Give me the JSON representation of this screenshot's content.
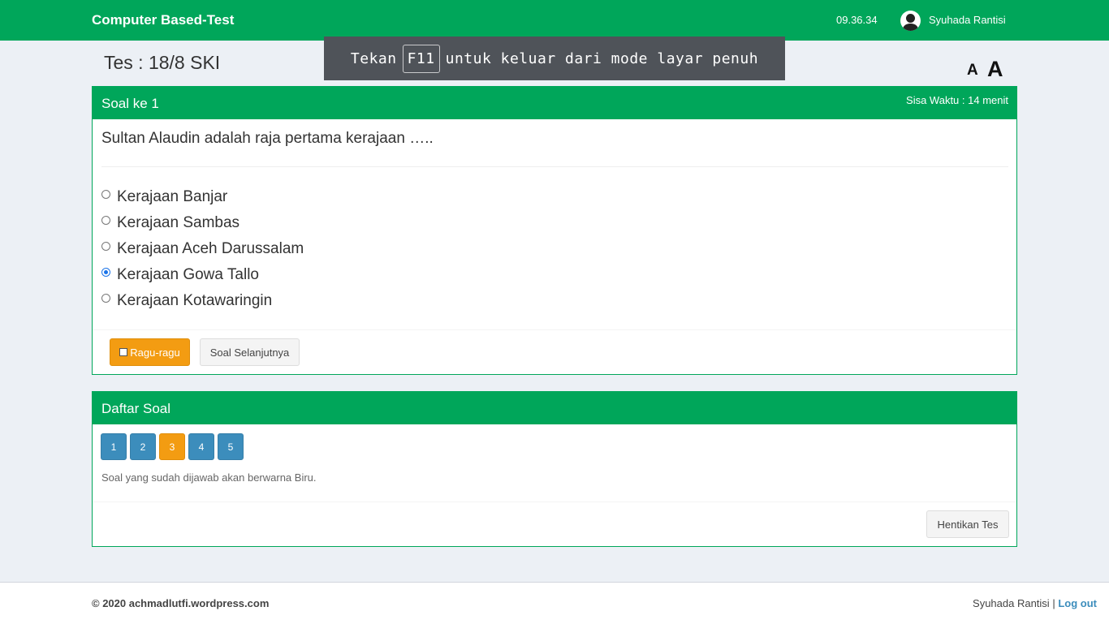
{
  "navbar": {
    "brand": "Computer Based-Test",
    "time": "09.36.34",
    "username": "Syuhada Rantisi",
    "avatar_icon": "user-avatar-icon"
  },
  "page": {
    "test_title": "Tes : 18/8 SKI",
    "font_small_label": "A",
    "font_large_label": "A"
  },
  "fullscreen_banner": {
    "before": "Tekan",
    "key": "F11",
    "after": "untuk keluar dari mode layar penuh"
  },
  "question_box": {
    "title": "Soal ke 1",
    "timer": "Sisa Waktu : 14 menit",
    "question": "Sultan Alaudin adalah raja pertama kerajaan …..",
    "options": [
      {
        "label": "Kerajaan Banjar",
        "checked": false
      },
      {
        "label": "Kerajaan Sambas",
        "checked": false
      },
      {
        "label": "Kerajaan Aceh Darussalam",
        "checked": false
      },
      {
        "label": "Kerajaan Gowa Tallo",
        "checked": true
      },
      {
        "label": "Kerajaan Kotawaringin",
        "checked": false
      }
    ],
    "doubt_label": "Ragu-ragu",
    "next_label": "Soal Selanjutnya"
  },
  "question_list": {
    "title": "Daftar Soal",
    "numbers": [
      {
        "label": "1",
        "status": "answered"
      },
      {
        "label": "2",
        "status": "answered"
      },
      {
        "label": "3",
        "status": "doubt"
      },
      {
        "label": "4",
        "status": "answered"
      },
      {
        "label": "5",
        "status": "answered"
      }
    ],
    "hint": "Soal yang sudah dijawab akan berwarna Biru.",
    "stop_label": "Hentikan Tes"
  },
  "footer": {
    "copyright": "© 2020 achmadlutfi.wordpress.com",
    "username": "Syuhada Rantisi",
    "separator": "|",
    "logout": "Log out"
  },
  "colors": {
    "primary_green": "#00a65a",
    "answered_blue": "#3c8dbc",
    "doubt_orange": "#f39c12",
    "background": "#ecf0f5"
  }
}
